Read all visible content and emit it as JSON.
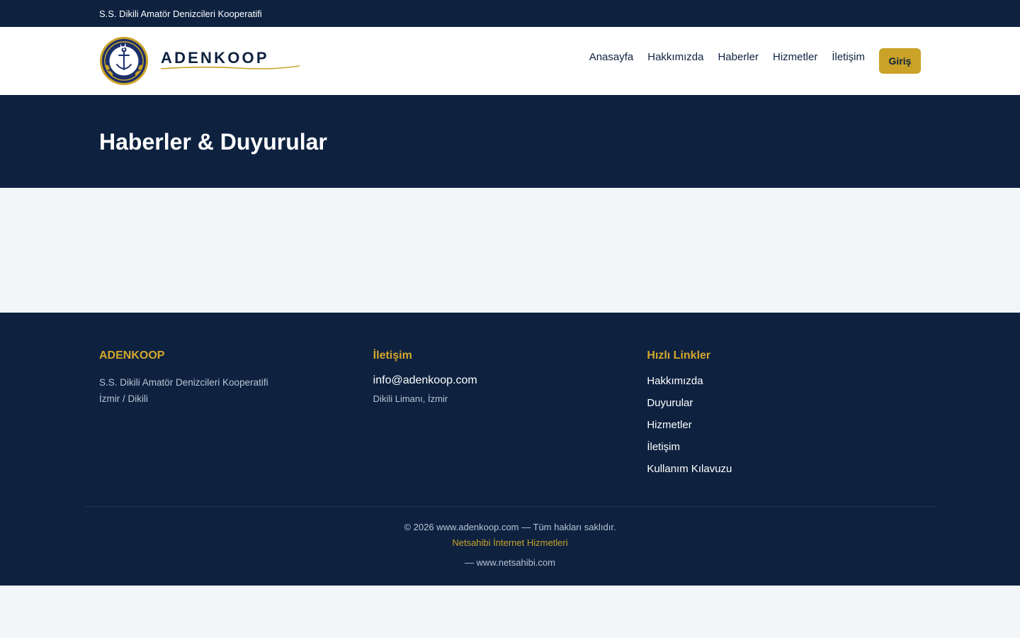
{
  "topbar": {
    "org_name": "S.S. Dikili Amatör Denizcileri Kooperatifi"
  },
  "header": {
    "brand": "ADENKOOP",
    "nav": [
      "Anasayfa",
      "Hakkımızda",
      "Haberler",
      "Hizmetler",
      "İletişim"
    ],
    "login_label": "Giriş"
  },
  "hero": {
    "title": "Haberler & Duyurular"
  },
  "footer": {
    "col1": {
      "title": "ADENKOOP",
      "line1": "S.S. Dikili Amatör Denizcileri Kooperatifi",
      "line2": "İzmir / Dikili"
    },
    "col2": {
      "title": "İletişim",
      "email": "info@adenkoop.com",
      "address": "Dikili Limanı, İzmir"
    },
    "col3": {
      "title": "Hızlı Linkler",
      "links": [
        "Hakkımızda",
        "Duyurular",
        "Hizmetler",
        "İletişim",
        "Kullanım Kılavuzu"
      ]
    },
    "copyright": "© 2026 www.adenkoop.com — Tüm hakları saklıdır.",
    "provider": "Netsahibi İnternet Hizmetleri",
    "provider_site": "— www.netsahibi.com"
  },
  "colors": {
    "navy": "#0e2240",
    "gold": "#c9a227",
    "background": "#f3f6f9"
  },
  "icons": {
    "logo": "cooperative-emblem-anchor"
  }
}
